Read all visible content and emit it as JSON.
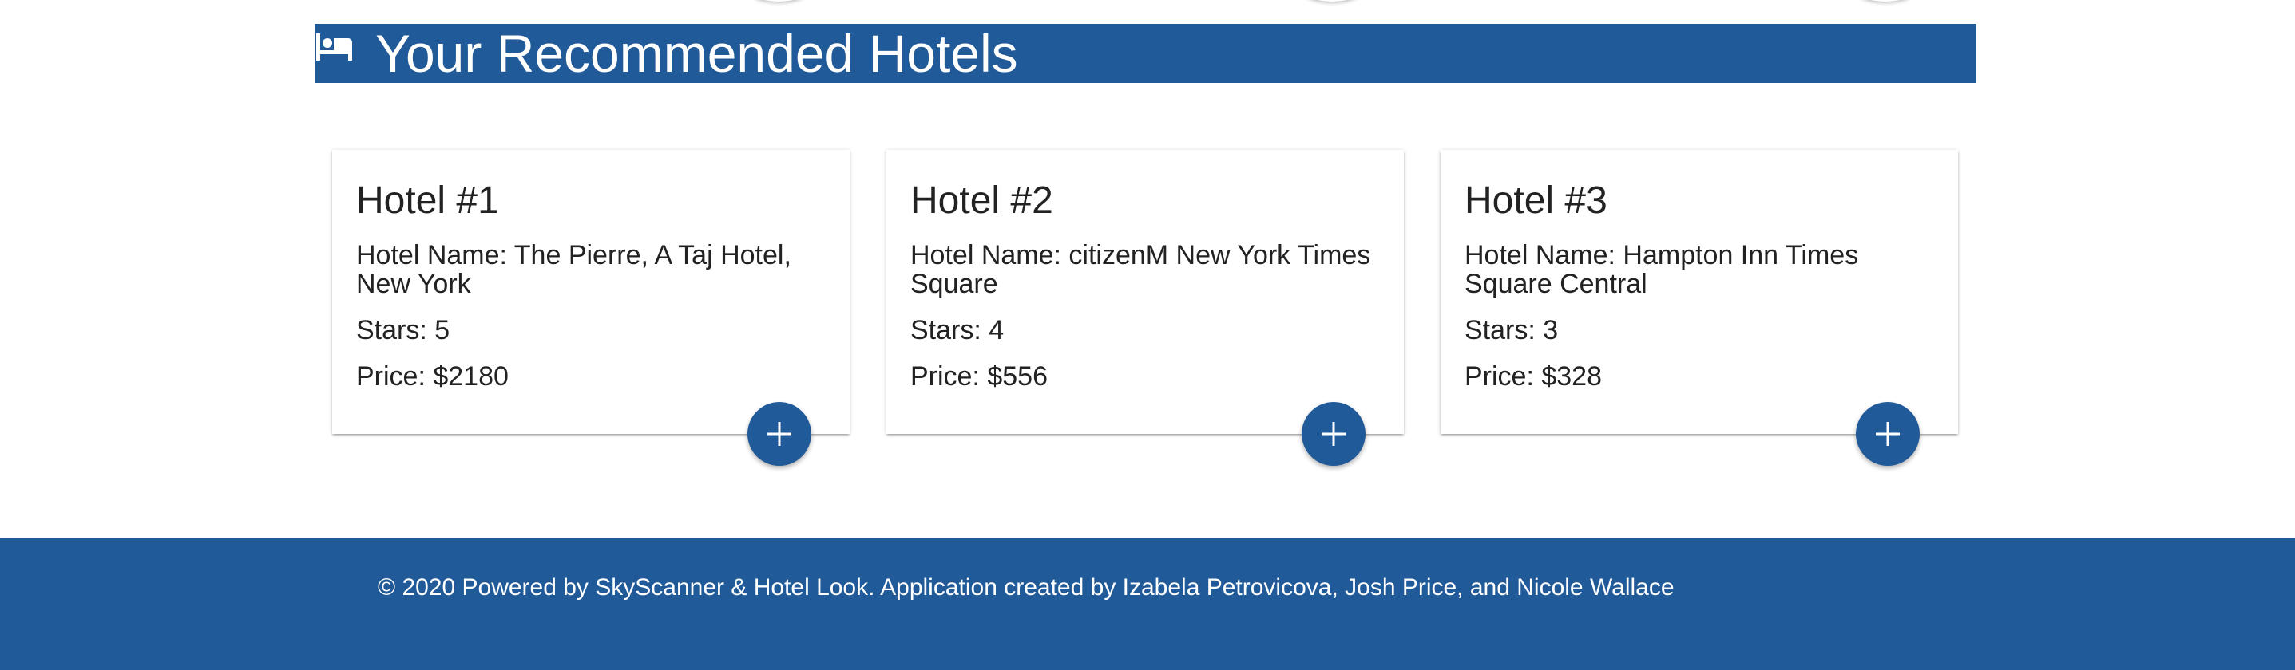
{
  "section": {
    "title": "Your Recommended Hotels",
    "icon": "bed-icon"
  },
  "hotels": [
    {
      "title": "Hotel #1",
      "name_line": "Hotel Name: The Pierre, A Taj Hotel, New York",
      "stars_line": "Stars: 5",
      "price_line": "Price: $2180",
      "add_icon": "plus-icon"
    },
    {
      "title": "Hotel #2",
      "name_line": "Hotel Name: citizenM New York Times Square",
      "stars_line": "Stars: 4",
      "price_line": "Price: $556",
      "add_icon": "plus-icon"
    },
    {
      "title": "Hotel #3",
      "name_line": "Hotel Name: Hampton Inn Times Square Central",
      "stars_line": "Stars: 3",
      "price_line": "Price: $328",
      "add_icon": "plus-icon"
    }
  ],
  "footer": {
    "text": "© 2020 Powered by SkyScanner & Hotel Look. Application created by Izabela Petrovicova, Josh Price, and Nicole Wallace"
  },
  "colors": {
    "primary": "#215a99",
    "text": "#222222",
    "background": "#ffffff"
  }
}
